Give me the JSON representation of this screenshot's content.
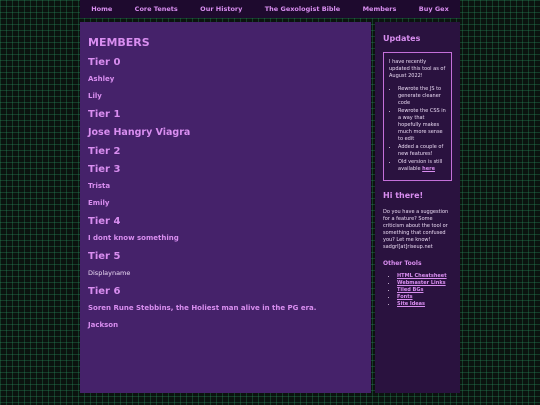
{
  "nav": {
    "items": [
      {
        "label": "Home"
      },
      {
        "label": "Core Tenets"
      },
      {
        "label": "Our History"
      },
      {
        "label": "The Gexologist Bible"
      },
      {
        "label": "Members"
      },
      {
        "label": "Buy Gex"
      }
    ]
  },
  "main": {
    "title": "MEMBERS",
    "tier0": {
      "label": "Tier 0",
      "members": [
        "Ashley",
        "Lily"
      ]
    },
    "tier1": {
      "label": "Tier 1",
      "members": [
        "Jose Hangry Viagra"
      ]
    },
    "tier2": {
      "label": "Tier 2"
    },
    "tier3": {
      "label": "Tier 3",
      "members": [
        "Trista",
        "Emily"
      ]
    },
    "tier4": {
      "label": "Tier 4",
      "members": [
        "I dont know something"
      ]
    },
    "tier5": {
      "label": "Tier 5",
      "members": [
        "Displayname"
      ]
    },
    "tier6": {
      "label": "Tier 6",
      "members": [
        "Soren Rune Stebbins, the Holiest man alive in the PG era.",
        "Jackson"
      ]
    }
  },
  "sidebar": {
    "updates_heading": "Updates",
    "update_intro": "I have recently updated this tool as of August 2022!",
    "update_items": [
      "Rewrote the JS to generate cleaner code",
      "Rewrote the CSS in a way that hopefully makes much more sense to edit",
      "Added a couple of new features!"
    ],
    "old_version_text": "Old version is still available",
    "old_version_link": "here",
    "hi_heading": "Hi there!",
    "hi_text": "Do you have a suggestion for a feature? Some criticism about the tool or something that confused you? Let me know! sadgrl[at]riseup.net",
    "other_tools_heading": "Other Tools",
    "tools": [
      {
        "label": "HTML Cheatsheet"
      },
      {
        "label": "Webmaster Links"
      },
      {
        "label": "Tiled BGs"
      },
      {
        "label": "Fonts"
      },
      {
        "label": "Site Ideas"
      }
    ]
  }
}
